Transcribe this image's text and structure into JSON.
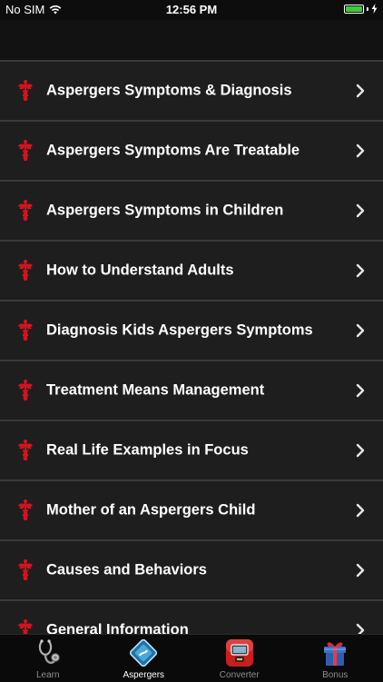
{
  "status_bar": {
    "carrier": "No SIM",
    "time": "12:56 PM",
    "wifi_icon": "wifi-icon",
    "battery_icon": "battery-icon",
    "charging_icon": "charging-bolt-icon"
  },
  "list": {
    "item_icon": "caduceus-icon",
    "chevron_icon": "chevron-right-icon",
    "items": [
      {
        "label": "Aspergers Symptoms & Diagnosis"
      },
      {
        "label": "Aspergers Symptoms Are Treatable"
      },
      {
        "label": "Aspergers Symptoms in Children"
      },
      {
        "label": "How to Understand Adults"
      },
      {
        "label": "Diagnosis Kids Aspergers Symptoms"
      },
      {
        "label": "Treatment Means Management"
      },
      {
        "label": "Real Life Examples in Focus"
      },
      {
        "label": "Mother of an Aspergers Child"
      },
      {
        "label": "Causes and Behaviors"
      },
      {
        "label": "General Information"
      }
    ]
  },
  "tabbar": {
    "active_tab": "Aspergers",
    "tabs": [
      {
        "label": "Learn",
        "icon": "stethoscope-icon"
      },
      {
        "label": "Aspergers",
        "icon": "diamond-badge-icon"
      },
      {
        "label": "Converter",
        "icon": "converter-icon"
      },
      {
        "label": "Bonus",
        "icon": "gift-icon"
      }
    ]
  },
  "colors": {
    "row_background": "#1e1e1e",
    "separator": "#3a3a3a",
    "icon_red": "#d4131c",
    "active_tab_label": "#ffffff",
    "inactive_tab_label": "#8e8e8e",
    "battery_green": "#3ec93e"
  }
}
